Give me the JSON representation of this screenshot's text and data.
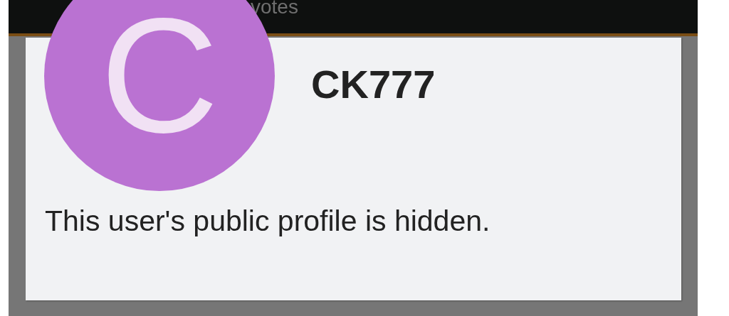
{
  "background_bar": {
    "text": "votes"
  },
  "dialog": {
    "avatar": {
      "letter": "C",
      "color": "#ba72d2"
    },
    "username": "CK777",
    "message": "This user's public profile is hidden."
  }
}
